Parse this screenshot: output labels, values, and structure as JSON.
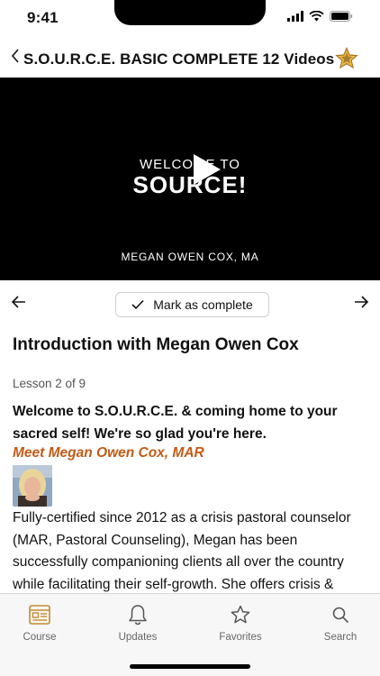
{
  "status_bar": {
    "time": "9:41"
  },
  "header": {
    "title": "S.O.U.R.C.E. BASIC COMPLETE 12 Videos",
    "back_icon": "chevron-left-icon",
    "badge_icon": "star-badge-icon"
  },
  "video": {
    "welcome_text": "WELCOME TO",
    "source_text": "SOURCE!",
    "credit_text": "MEGAN OWEN COX, MA",
    "play_icon": "play-icon"
  },
  "lesson_nav": {
    "previous_icon": "arrow-left-icon",
    "next_icon": "arrow-right-icon",
    "mark_complete_label": "Mark as complete"
  },
  "lesson": {
    "title": "Introduction with Megan Owen Cox",
    "count": "Lesson 2 of 9",
    "intro": "Welcome to S.O.U.R.C.E. & coming home to your sacred self! We're so glad you're here.",
    "meet_link": "Meet Megan Owen Cox, MAR",
    "bio": "Fully-certified since 2012 as a crisis pastoral counselor (MAR, Pastoral Counseling), Megan has been successfully companioning clients all over the country while facilitating their self-growth. She offers crisis &"
  },
  "tabs": [
    {
      "label": "Course",
      "icon": "course-icon"
    },
    {
      "label": "Updates",
      "icon": "bell-icon"
    },
    {
      "label": "Favorites",
      "icon": "star-icon"
    },
    {
      "label": "Search",
      "icon": "search-icon"
    }
  ],
  "colors": {
    "accent": "#c25a14",
    "tab_active": "#c78a2e",
    "video_bg": "#000000"
  }
}
